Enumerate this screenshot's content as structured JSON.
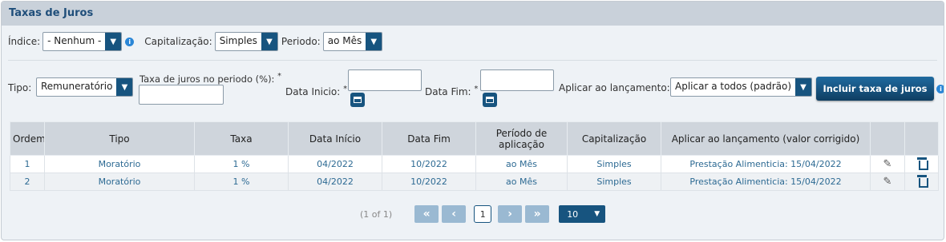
{
  "panel": {
    "title": "Taxas de Juros"
  },
  "filters": {
    "indice_label": "Índice:",
    "indice_value": "- Nenhum -",
    "capitalizacao_label": "Capitalização:",
    "capitalizacao_value": "Simples",
    "periodo_label": "Periodo:",
    "periodo_value": "ao Mês"
  },
  "form": {
    "tipo_label": "Tipo:",
    "tipo_value": "Remuneratório",
    "taxa_label": "Taxa de juros no periodo (%):",
    "required_mark": "*",
    "data_inicio_label": "Data Inicio:",
    "data_fim_label": "Data Fim:",
    "aplicar_label": "Aplicar ao lançamento:",
    "aplicar_value": "Aplicar a todos (padrão)",
    "incluir_button": "Incluir taxa de juros"
  },
  "table": {
    "headers": [
      "Ordem",
      "Tipo",
      "Taxa",
      "Data Início",
      "Data Fim",
      "Período de aplicação",
      "Capitalização",
      "Aplicar ao lançamento (valor corrigido)",
      "",
      ""
    ],
    "rows": [
      {
        "ordem": "1",
        "tipo": "Moratório",
        "taxa": "1 %",
        "inicio": "04/2022",
        "fim": "10/2022",
        "periodo": "ao Mês",
        "cap": "Simples",
        "aplicar": "Prestação Alimenticia: 15/04/2022"
      },
      {
        "ordem": "2",
        "tipo": "Moratório",
        "taxa": "1 %",
        "inicio": "04/2022",
        "fim": "10/2022",
        "periodo": "ao Mês",
        "cap": "Simples",
        "aplicar": "Prestação Alimenticia: 15/04/2022"
      }
    ]
  },
  "pagination": {
    "summary": "(1 of 1)",
    "current_page": "1",
    "page_size": "10"
  }
}
